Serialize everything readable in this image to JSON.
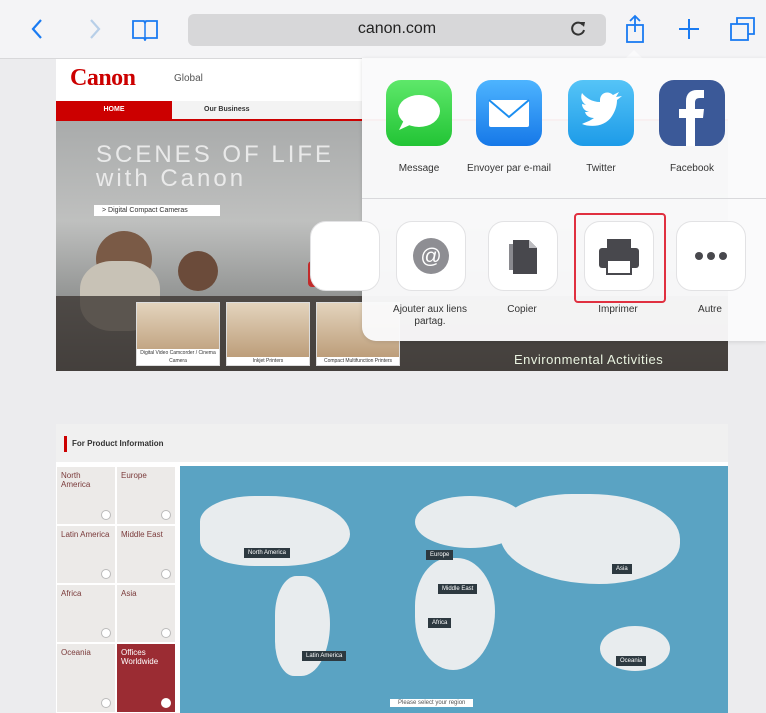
{
  "toolbar": {
    "back_icon": "chevron-left-icon",
    "forward_icon": "chevron-right-icon",
    "bookmarks_icon": "book-icon",
    "url": "canon.com",
    "reload_icon": "reload-icon",
    "share_icon": "share-icon",
    "new_tab_icon": "plus-icon",
    "tabs_icon": "tabs-icon",
    "accent": "#1a7bf2"
  },
  "website": {
    "logo": "Canon",
    "logo_sub": "Global",
    "nav": [
      "HOME",
      "Our Business"
    ],
    "hero_title": [
      "SCENES OF LIFE",
      "with Canon"
    ],
    "hero_link": "> Digital Compact Cameras",
    "thumbnails": [
      "Digital Video Camcorder / Cinema Camera",
      "Inkjet Printers",
      "Compact Multifunction Printers"
    ],
    "env_text": "Environmental Activities",
    "product_title": "For Product Information",
    "regions": [
      "North America",
      "Europe",
      "Latin America",
      "Middle East",
      "Africa",
      "Asia",
      "Oceania",
      "Offices Worldwide"
    ],
    "map_labels": [
      "North America",
      "Europe",
      "Middle East",
      "Asia",
      "Africa",
      "Latin America",
      "Oceania"
    ],
    "map_footer": "Please select your region"
  },
  "share_sheet": {
    "apps": [
      {
        "label": "Message",
        "icon": "message-icon",
        "color": "#3ed34a"
      },
      {
        "label": "Envoyer par e-mail",
        "icon": "mail-icon",
        "color": "#1b8ef0"
      },
      {
        "label": "Twitter",
        "icon": "twitter-icon",
        "color": "#1da1f2"
      },
      {
        "label": "Facebook",
        "icon": "facebook-icon",
        "color": "#3b5998"
      }
    ],
    "actions": [
      {
        "label": "Ajouter aux liens partag.",
        "icon": "at-icon"
      },
      {
        "label": "Copier",
        "icon": "copy-icon"
      },
      {
        "label": "Imprimer",
        "icon": "printer-icon"
      },
      {
        "label": "Autre",
        "icon": "more-icon"
      }
    ],
    "highlight_color": "#e03040"
  }
}
